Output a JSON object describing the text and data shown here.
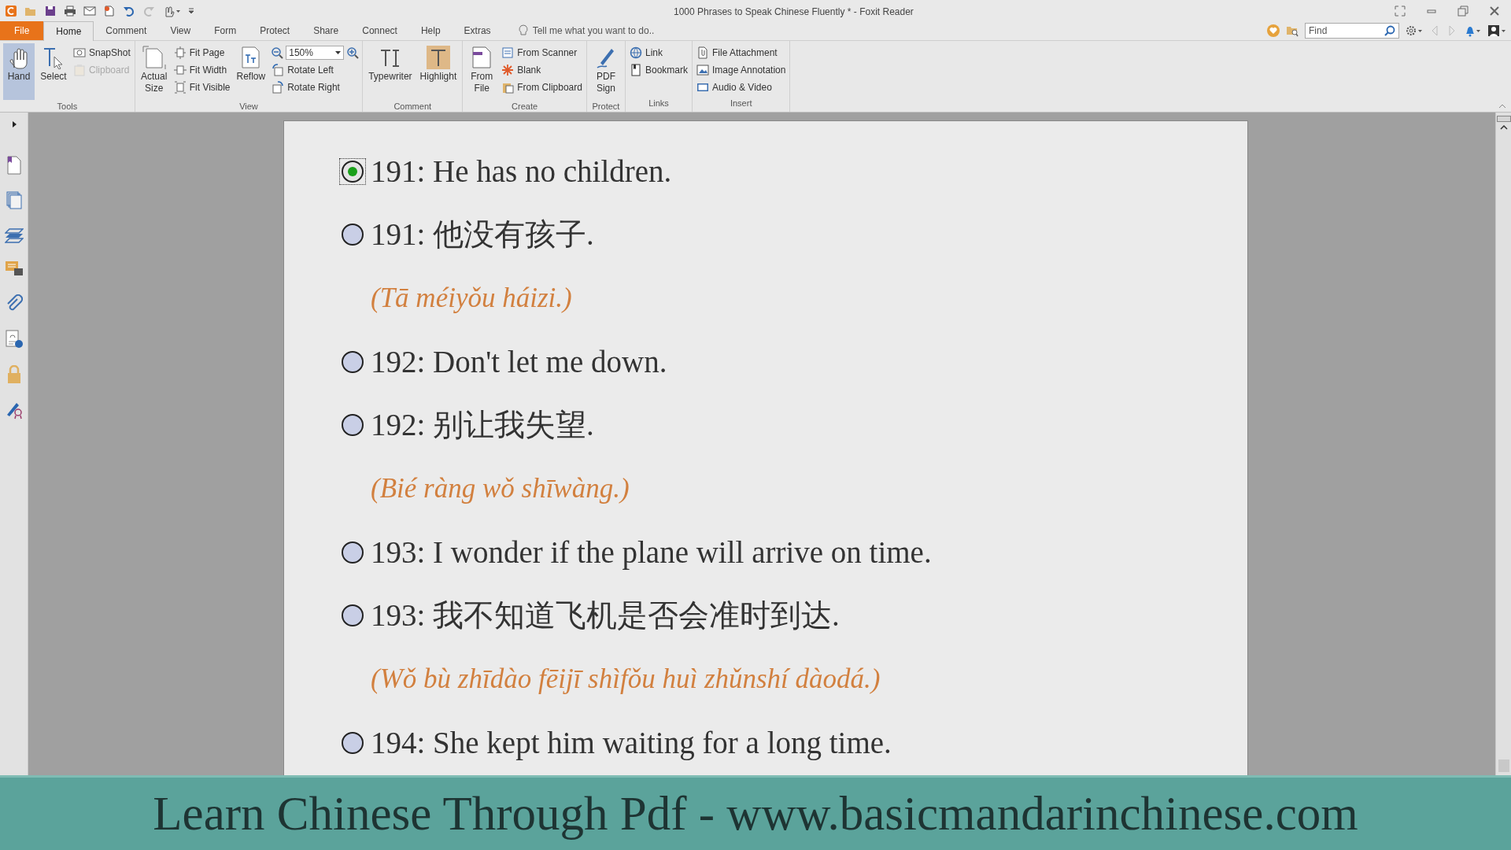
{
  "window": {
    "title": "1000 Phrases to Speak Chinese Fluently * - Foxit Reader"
  },
  "menu_tabs": [
    {
      "label": "File",
      "selected": false,
      "kind": "file"
    },
    {
      "label": "Home",
      "selected": true,
      "kind": "tab"
    },
    {
      "label": "Comment",
      "selected": false,
      "kind": "tab"
    },
    {
      "label": "View",
      "selected": false,
      "kind": "tab"
    },
    {
      "label": "Form",
      "selected": false,
      "kind": "tab"
    },
    {
      "label": "Protect",
      "selected": false,
      "kind": "tab"
    },
    {
      "label": "Share",
      "selected": false,
      "kind": "tab"
    },
    {
      "label": "Connect",
      "selected": false,
      "kind": "tab"
    },
    {
      "label": "Help",
      "selected": false,
      "kind": "tab"
    },
    {
      "label": "Extras",
      "selected": false,
      "kind": "tab"
    }
  ],
  "tell_me": {
    "placeholder": "Tell me what you want to do.."
  },
  "find": {
    "placeholder": "Find"
  },
  "ribbon": [
    {
      "label": "Tools",
      "items": [
        {
          "kind": "big",
          "label": "Hand",
          "selected": true,
          "disabled": false
        },
        {
          "kind": "big",
          "label": "Select",
          "selected": false,
          "disabled": false
        },
        {
          "kind": "small",
          "label": "SnapShot",
          "selected": false,
          "disabled": false
        },
        {
          "kind": "small",
          "label": "Clipboard",
          "selected": false,
          "disabled": true
        }
      ]
    },
    {
      "label": "View",
      "items": [
        {
          "kind": "big",
          "label": "Actual Size",
          "selected": false,
          "disabled": false
        },
        {
          "kind": "small",
          "label": "Fit Page",
          "selected": false,
          "disabled": false
        },
        {
          "kind": "small",
          "label": "Fit Width",
          "selected": false,
          "disabled": false
        },
        {
          "kind": "small",
          "label": "Fit Visible",
          "selected": false,
          "disabled": false
        },
        {
          "kind": "big",
          "label": "Reflow",
          "selected": false,
          "disabled": false
        },
        {
          "kind": "zoom",
          "label": "150%",
          "selected": false,
          "disabled": false
        },
        {
          "kind": "small",
          "label": "Rotate Left",
          "selected": false,
          "disabled": false
        },
        {
          "kind": "small",
          "label": "Rotate Right",
          "selected": false,
          "disabled": false
        }
      ]
    },
    {
      "label": "Comment",
      "items": [
        {
          "kind": "big",
          "label": "Typewriter",
          "selected": false,
          "disabled": false
        },
        {
          "kind": "big",
          "label": "Highlight",
          "selected": false,
          "disabled": false
        }
      ]
    },
    {
      "label": "Create",
      "items": [
        {
          "kind": "big",
          "label": "From File",
          "selected": false,
          "disabled": false
        },
        {
          "kind": "small",
          "label": "From Scanner",
          "selected": false,
          "disabled": false
        },
        {
          "kind": "small",
          "label": "Blank",
          "selected": false,
          "disabled": false
        },
        {
          "kind": "small",
          "label": "From Clipboard",
          "selected": false,
          "disabled": false
        }
      ]
    },
    {
      "label": "Protect",
      "items": [
        {
          "kind": "big",
          "label": "PDF Sign",
          "selected": false,
          "disabled": false
        }
      ]
    },
    {
      "label": "Links",
      "items": [
        {
          "kind": "small",
          "label": "Link",
          "selected": false,
          "disabled": false
        },
        {
          "kind": "small",
          "label": "Bookmark",
          "selected": false,
          "disabled": false
        }
      ]
    },
    {
      "label": "Insert",
      "items": [
        {
          "kind": "small",
          "label": "File Attachment",
          "selected": false,
          "disabled": false
        },
        {
          "kind": "small",
          "label": "Image Annotation",
          "selected": false,
          "disabled": false
        },
        {
          "kind": "small",
          "label": "Audio & Video",
          "selected": false,
          "disabled": false
        }
      ]
    }
  ],
  "document": [
    {
      "kind": "phrase",
      "text": "191: He has no children.",
      "selected": true
    },
    {
      "kind": "phrase",
      "text": "191: 他没有孩子.",
      "selected": false
    },
    {
      "kind": "pinyin",
      "text": "(Tā méiyǒu háizi.)"
    },
    {
      "kind": "phrase",
      "text": "192: Don't let me down.",
      "selected": false
    },
    {
      "kind": "phrase",
      "text": "192: 别让我失望.",
      "selected": false
    },
    {
      "kind": "pinyin",
      "text": "(Bié ràng wǒ shīwàng.)"
    },
    {
      "kind": "phrase",
      "text": "193: I wonder if the plane will arrive on time.",
      "selected": false
    },
    {
      "kind": "phrase",
      "text": "193: 我不知道飞机是否会准时到达.",
      "selected": false
    },
    {
      "kind": "pinyin",
      "text": "(Wǒ bù zhīdào fēijī shìfǒu huì zhǔnshí dàodá.)"
    },
    {
      "kind": "phrase",
      "text": "194: She kept him waiting for a long time.",
      "selected": false
    }
  ],
  "banner": {
    "text": "Learn Chinese Through Pdf - www.basicmandarinchinese.com"
  }
}
